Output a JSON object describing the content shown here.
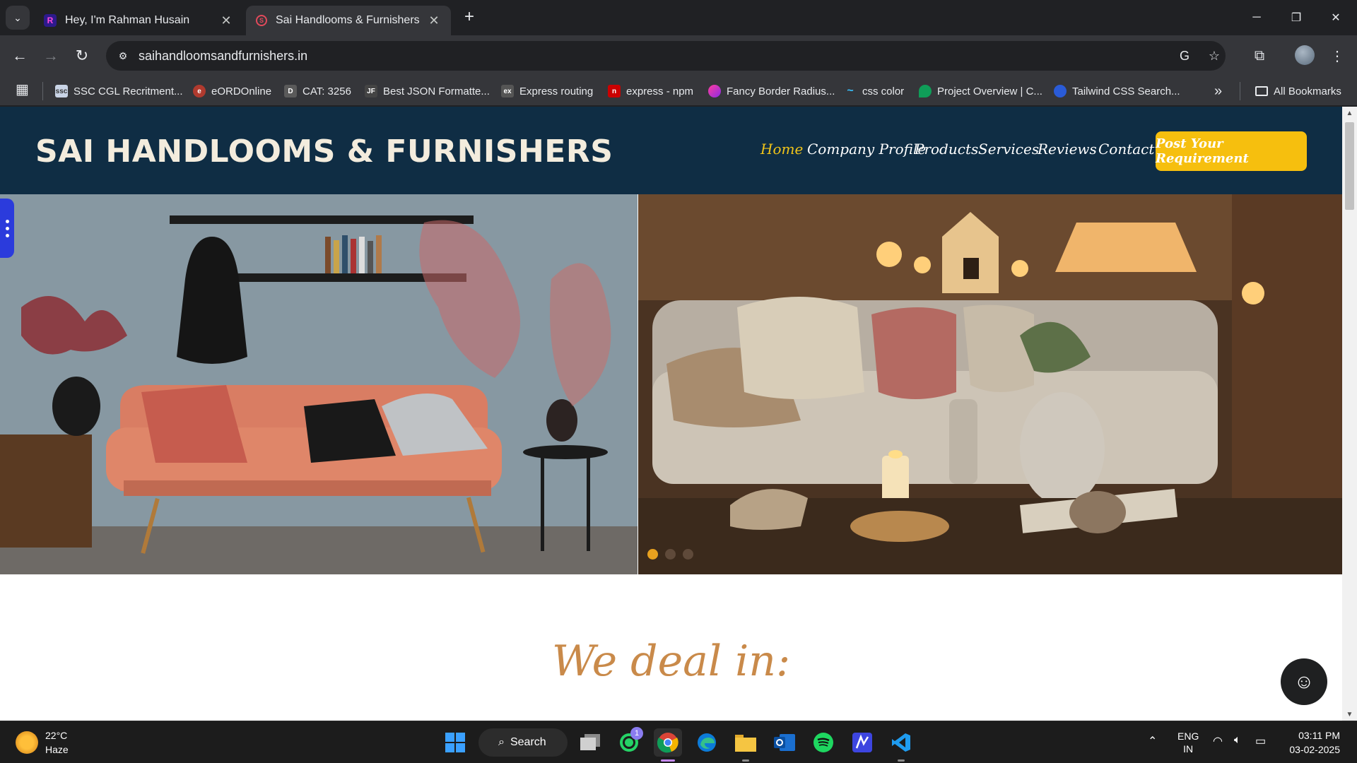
{
  "browser": {
    "tabs": [
      {
        "title": "Hey, I'm Rahman Husain",
        "favicon": "R"
      },
      {
        "title": "Sai Handlooms & Furnishers",
        "favicon": "S"
      }
    ],
    "url": "saihandloomsandfurnishers.in"
  },
  "bookmarks": [
    {
      "label": "SSC CGL Recritment...",
      "icon_text": "ssc",
      "color": "#c9d4e6"
    },
    {
      "label": "eORDOnline",
      "icon_text": "e",
      "color": "#b03a2e"
    },
    {
      "label": "CAT: 3256",
      "icon_text": "D",
      "color": "#5a5a5a"
    },
    {
      "label": "Best JSON Formatte...",
      "icon_text": "JF",
      "color": "#444"
    },
    {
      "label": "Express routing",
      "icon_text": "ex",
      "color": "#555"
    },
    {
      "label": "express - npm",
      "icon_text": "n",
      "color": "#cb0000"
    },
    {
      "label": "Fancy Border Radius...",
      "icon_text": "",
      "color": "#c81ac8"
    },
    {
      "label": "css color",
      "icon_text": "~",
      "color": "#38bdf8"
    },
    {
      "label": "Project Overview | C...",
      "icon_text": "",
      "color": "#0f9d58"
    },
    {
      "label": "Tailwind CSS Search...",
      "icon_text": "",
      "color": "#2a5bd7"
    }
  ],
  "all_bookmarks": "All Bookmarks",
  "site": {
    "brand": "SAI HANDLOOMS & FURNISHERS",
    "nav": [
      "Home",
      "Company Profile",
      "Products",
      "Services",
      "Reviews",
      "Contact"
    ],
    "cta": "Post Your Requirement",
    "section_title": "We deal in:",
    "accent": "#f6bf0e",
    "header_bg": "#0f2d44"
  },
  "taskbar": {
    "weather_temp": "22°C",
    "weather_desc": "Haze",
    "search": "Search",
    "whatsapp_badge": "1",
    "lang1": "ENG",
    "lang2": "IN",
    "time": "03:11 PM",
    "date": "03-02-2025"
  }
}
